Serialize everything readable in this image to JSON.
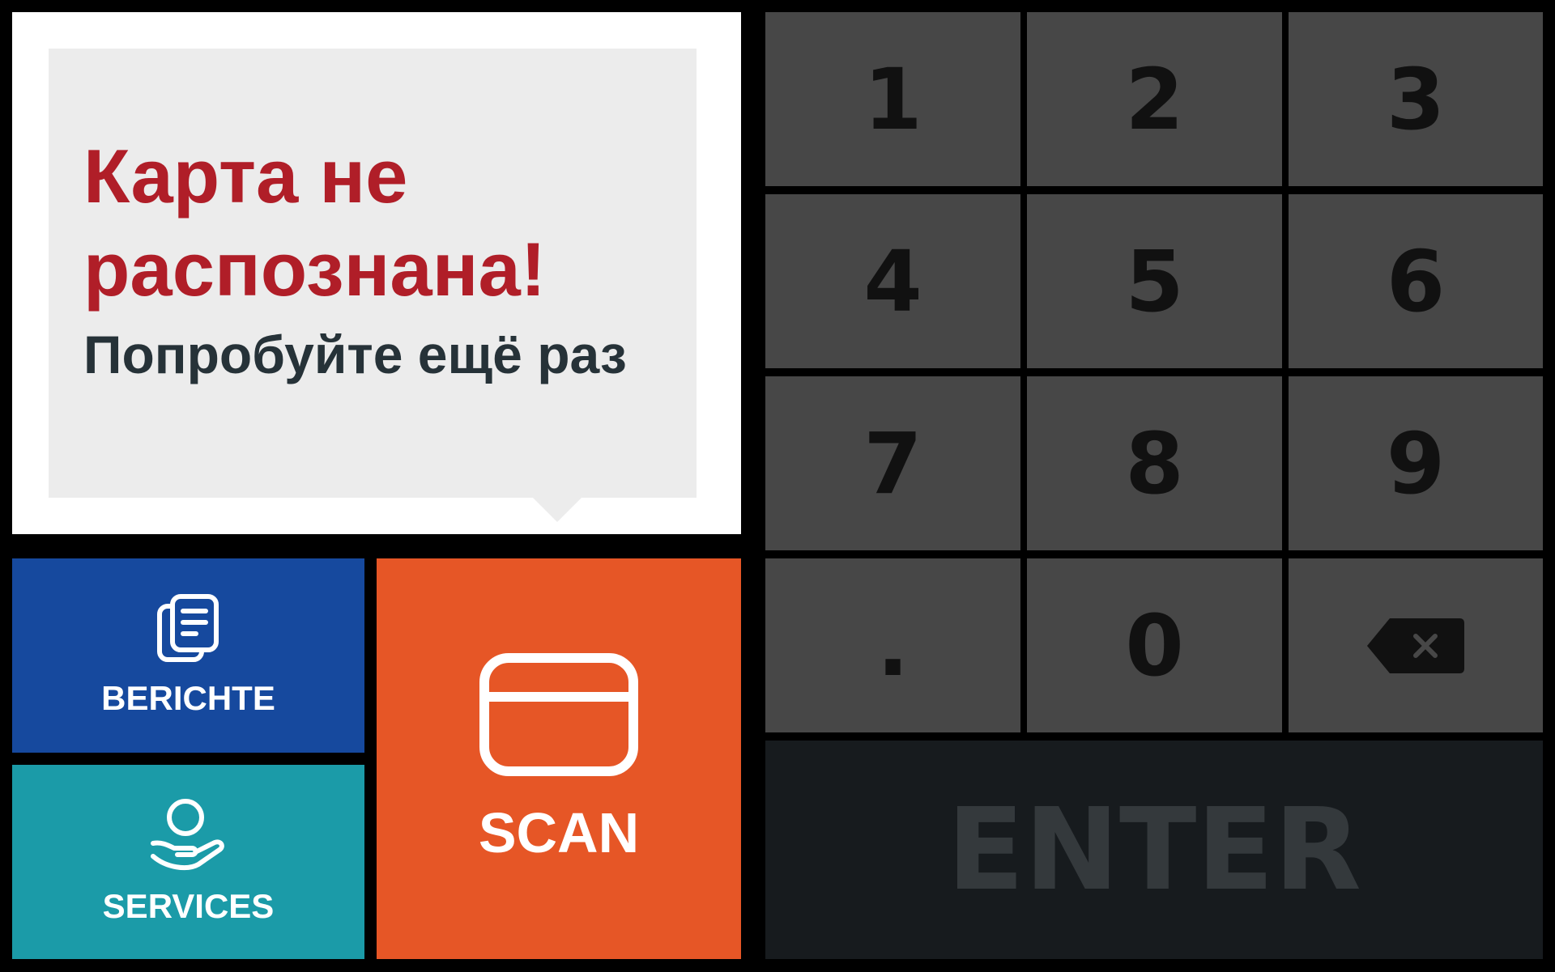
{
  "message": {
    "title": "Карта не распознана!",
    "subtitle": "Попробуйте ещё раз"
  },
  "tiles": {
    "reports": {
      "label": "BERICHTE",
      "icon": "documents-icon"
    },
    "services": {
      "label": "SERVICES",
      "icon": "person-hand-icon"
    },
    "scan": {
      "label": "SCAN",
      "icon": "card-icon"
    }
  },
  "keypad": {
    "keys": [
      "1",
      "2",
      "3",
      "4",
      "5",
      "6",
      "7",
      "8",
      "9",
      ".",
      "0"
    ],
    "backspace_icon": "backspace-icon",
    "enter_label": "ENTER"
  },
  "colors": {
    "error_title": "#b01e28",
    "subtitle": "#263238",
    "reports_tile": "#16499e",
    "services_tile": "#1b9ba8",
    "scan_tile": "#e65626",
    "key_bg": "#474747",
    "enter_bg": "#171b1e",
    "enter_text": "#34393c"
  }
}
